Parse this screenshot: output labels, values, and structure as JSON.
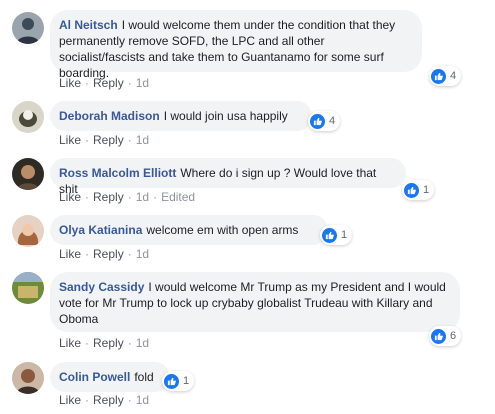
{
  "comments": [
    {
      "author": "Al Neitsch",
      "text": "I would welcome them under the condition that they permanently remove SOFD, the LPC and all other socialist/fascists and take them to Guantanamo for some surf boarding.",
      "like": "Like",
      "reply": "Reply",
      "time": "1d",
      "edited": "",
      "reactions": "4",
      "avatar_color": "#3d4a58"
    },
    {
      "author": "Deborah Madison",
      "text": "I would join usa happily",
      "like": "Like",
      "reply": "Reply",
      "time": "1d",
      "edited": "",
      "reactions": "4",
      "avatar_color": "#7a7a6a"
    },
    {
      "author": "Ross Malcolm Elliott",
      "text": "Where do i sign up ? Would love that shit",
      "like": "Like",
      "reply": "Reply",
      "time": "1d",
      "edited": "Edited",
      "reactions": "1",
      "avatar_color": "#5b4a3a"
    },
    {
      "author": "Olya Katianina",
      "text": "welcome em with open arms",
      "like": "Like",
      "reply": "Reply",
      "time": "1d",
      "edited": "",
      "reactions": "1",
      "avatar_color": "#c08a6a"
    },
    {
      "author": "Sandy Cassidy",
      "text": "I would welcome Mr Trump as my President and I would vote for Mr Trump to lock up crybaby globalist Trudeau with Killary and Oboma",
      "like": "Like",
      "reply": "Reply",
      "time": "1d",
      "edited": "",
      "reactions": "6",
      "avatar_color": "#8a9a4a"
    },
    {
      "author": "Colin Powell",
      "text": "fold",
      "like": "Like",
      "reply": "Reply",
      "time": "1d",
      "edited": "",
      "reactions": "1",
      "avatar_color": "#7a5a4a"
    }
  ]
}
